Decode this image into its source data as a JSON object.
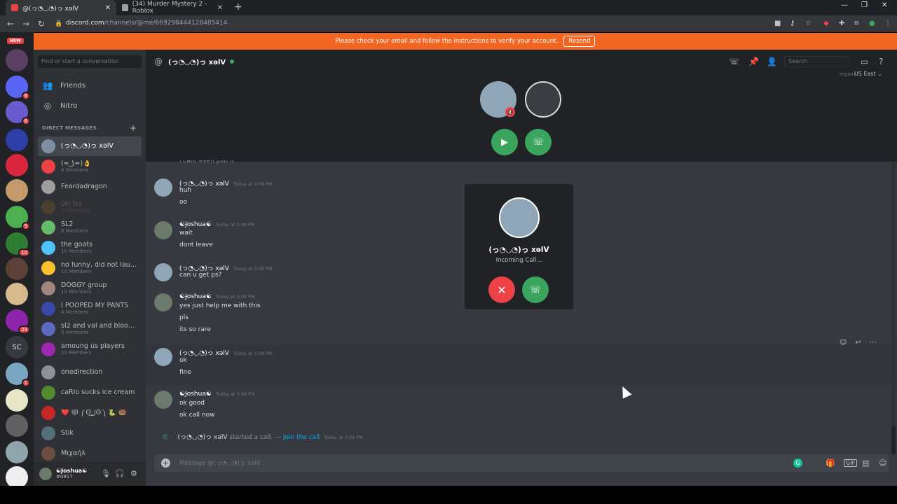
{
  "browser": {
    "tabs": [
      {
        "label": "@(っ◔◡◔)っ xəlV"
      },
      {
        "label": "(34) Murder Mystery 2 - Roblox"
      }
    ],
    "new_tab": "+",
    "url_host": "discord.com",
    "url_path": "/channels/@me/669298444128485414",
    "win_min": "—",
    "win_max": "❐",
    "win_close": "✕"
  },
  "banner": {
    "text": "Please check your email and follow the instructions to verify your account.",
    "button": "Resend"
  },
  "guilds": {
    "new_label": "NEW",
    "sc_label": "SC",
    "badges": [
      "6",
      "6",
      "5",
      "10",
      "24",
      "1"
    ]
  },
  "sidebar": {
    "search_placeholder": "Find or start a conversation",
    "friends": "Friends",
    "nitro": "Nitro",
    "dm_header": "DIRECT MESSAGES",
    "dms": [
      {
        "name": "(っ◔◡◔)っ xəlV",
        "sub": ""
      },
      {
        "name": "(≖ ͜ʖ≖)👌",
        "sub": "4 Members"
      },
      {
        "name": "Feardadragon",
        "sub": ""
      },
      {
        "name": "Oh No",
        "sub": "10 Members"
      },
      {
        "name": "SL2",
        "sub": "6 Members"
      },
      {
        "name": "the goats",
        "sub": "10 Members"
      },
      {
        "name": "no funny, did not laug...",
        "sub": "10 Members"
      },
      {
        "name": "DOGGY group",
        "sub": "10 Members"
      },
      {
        "name": "I POOPED MY PANTS",
        "sub": "4 Members"
      },
      {
        "name": "sl2 and val and blood ...",
        "sub": "5 Members"
      },
      {
        "name": "amoung us players",
        "sub": "10 Members"
      },
      {
        "name": "onedirection",
        "sub": ""
      },
      {
        "name": "caRlo sucks ice cream",
        "sub": ""
      },
      {
        "name": "❤️ 😻 ༼ʘ̚ل͜ʘ̚༽ 🐍 🍩",
        "sub": ""
      },
      {
        "name": "Stik",
        "sub": ""
      },
      {
        "name": "Μιχαήλ",
        "sub": ""
      }
    ],
    "user": {
      "name": "☯Ɉoshua☯",
      "tag": "#0817"
    }
  },
  "channel": {
    "name": "(っ◔◡◔)っ xəlV",
    "search_placeholder": "Search",
    "region_label": "region",
    "region_value": "US East ⌄"
  },
  "messages": [
    {
      "author": "(っ◔◡◔)っ xəlV",
      "time": "Today at 3:08 PM",
      "lines": [
        "huh",
        "oo"
      ]
    },
    {
      "author": "☯Ɉoshua☯",
      "time": "Today at 3:08 PM",
      "lines": [
        "wait",
        "dont leave"
      ]
    },
    {
      "author": "(っ◔◡◔)っ xəlV",
      "time": "Today at 3:08 PM",
      "lines": [
        "can u get ps?"
      ]
    },
    {
      "author": "☯Ɉoshua☯",
      "time": "Today at 3:08 PM",
      "lines": [
        "yes just help me with this",
        "pls",
        "its so rare"
      ]
    },
    {
      "author": "(っ◔◡◔)っ xəlV",
      "time": "Today at 3:08 PM",
      "lines": [
        "ok",
        "fine"
      ]
    },
    {
      "author": "☯Ɉoshua☯",
      "time": "Today at 3:08 PM",
      "lines": [
        "ok good",
        "ok call now"
      ]
    }
  ],
  "cutoff_line": "i cant even join it",
  "system": {
    "who": "(っ◔◡◔)っ xəlV",
    "text": " started a call. — ",
    "join": "Join the call",
    "time": "Today at 3:09 PM"
  },
  "composer": {
    "placeholder": "Message @(っ◔◡◔)っ xəlV"
  },
  "incoming": {
    "name": "(っ◔◡◔)っ xəlV",
    "status": "Incoming Call..."
  },
  "colors": {
    "accent_green": "#3ba55d",
    "danger_red": "#ed4245",
    "banner_orange": "#f26522",
    "link_blue": "#00aff4"
  },
  "icons": {
    "friends": "friends-icon",
    "nitro": "nitro-icon",
    "call": "phone-icon",
    "video": "video-icon",
    "decline": "close-icon"
  }
}
